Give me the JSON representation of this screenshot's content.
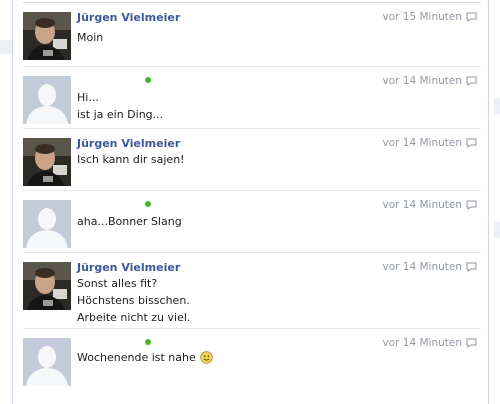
{
  "messages": [
    {
      "author": "Jürgen Vielmeier",
      "time": "vor 15 Minuten",
      "lines": [
        "Moin"
      ]
    },
    {
      "author": "",
      "time": "vor 14 Minuten",
      "lines": [
        "Hi...",
        "ist ja ein Ding..."
      ]
    },
    {
      "author": "Jürgen Vielmeier",
      "time": "vor 14 Minuten",
      "lines": [
        "Isch kann dir sajen!"
      ]
    },
    {
      "author": "",
      "time": "vor 14 Minuten",
      "lines": [
        "aha...Bonner Slang"
      ]
    },
    {
      "author": "Jürgen Vielmeier",
      "time": "vor 14 Minuten",
      "lines": [
        "Sonst alles fit?",
        "Höchstens bisschen.",
        "Arbeite nicht zu viel."
      ]
    },
    {
      "author": "",
      "time": "vor 14 Minuten",
      "lines": [
        "Wochenende ist nahe"
      ]
    }
  ],
  "colors": {
    "link": "#3b5998",
    "online": "#42b72a",
    "timestamp": "#9197a3"
  },
  "icons": {
    "reply": "reply-icon",
    "smiley": "smiley-icon",
    "avatar": "avatar-photo"
  }
}
